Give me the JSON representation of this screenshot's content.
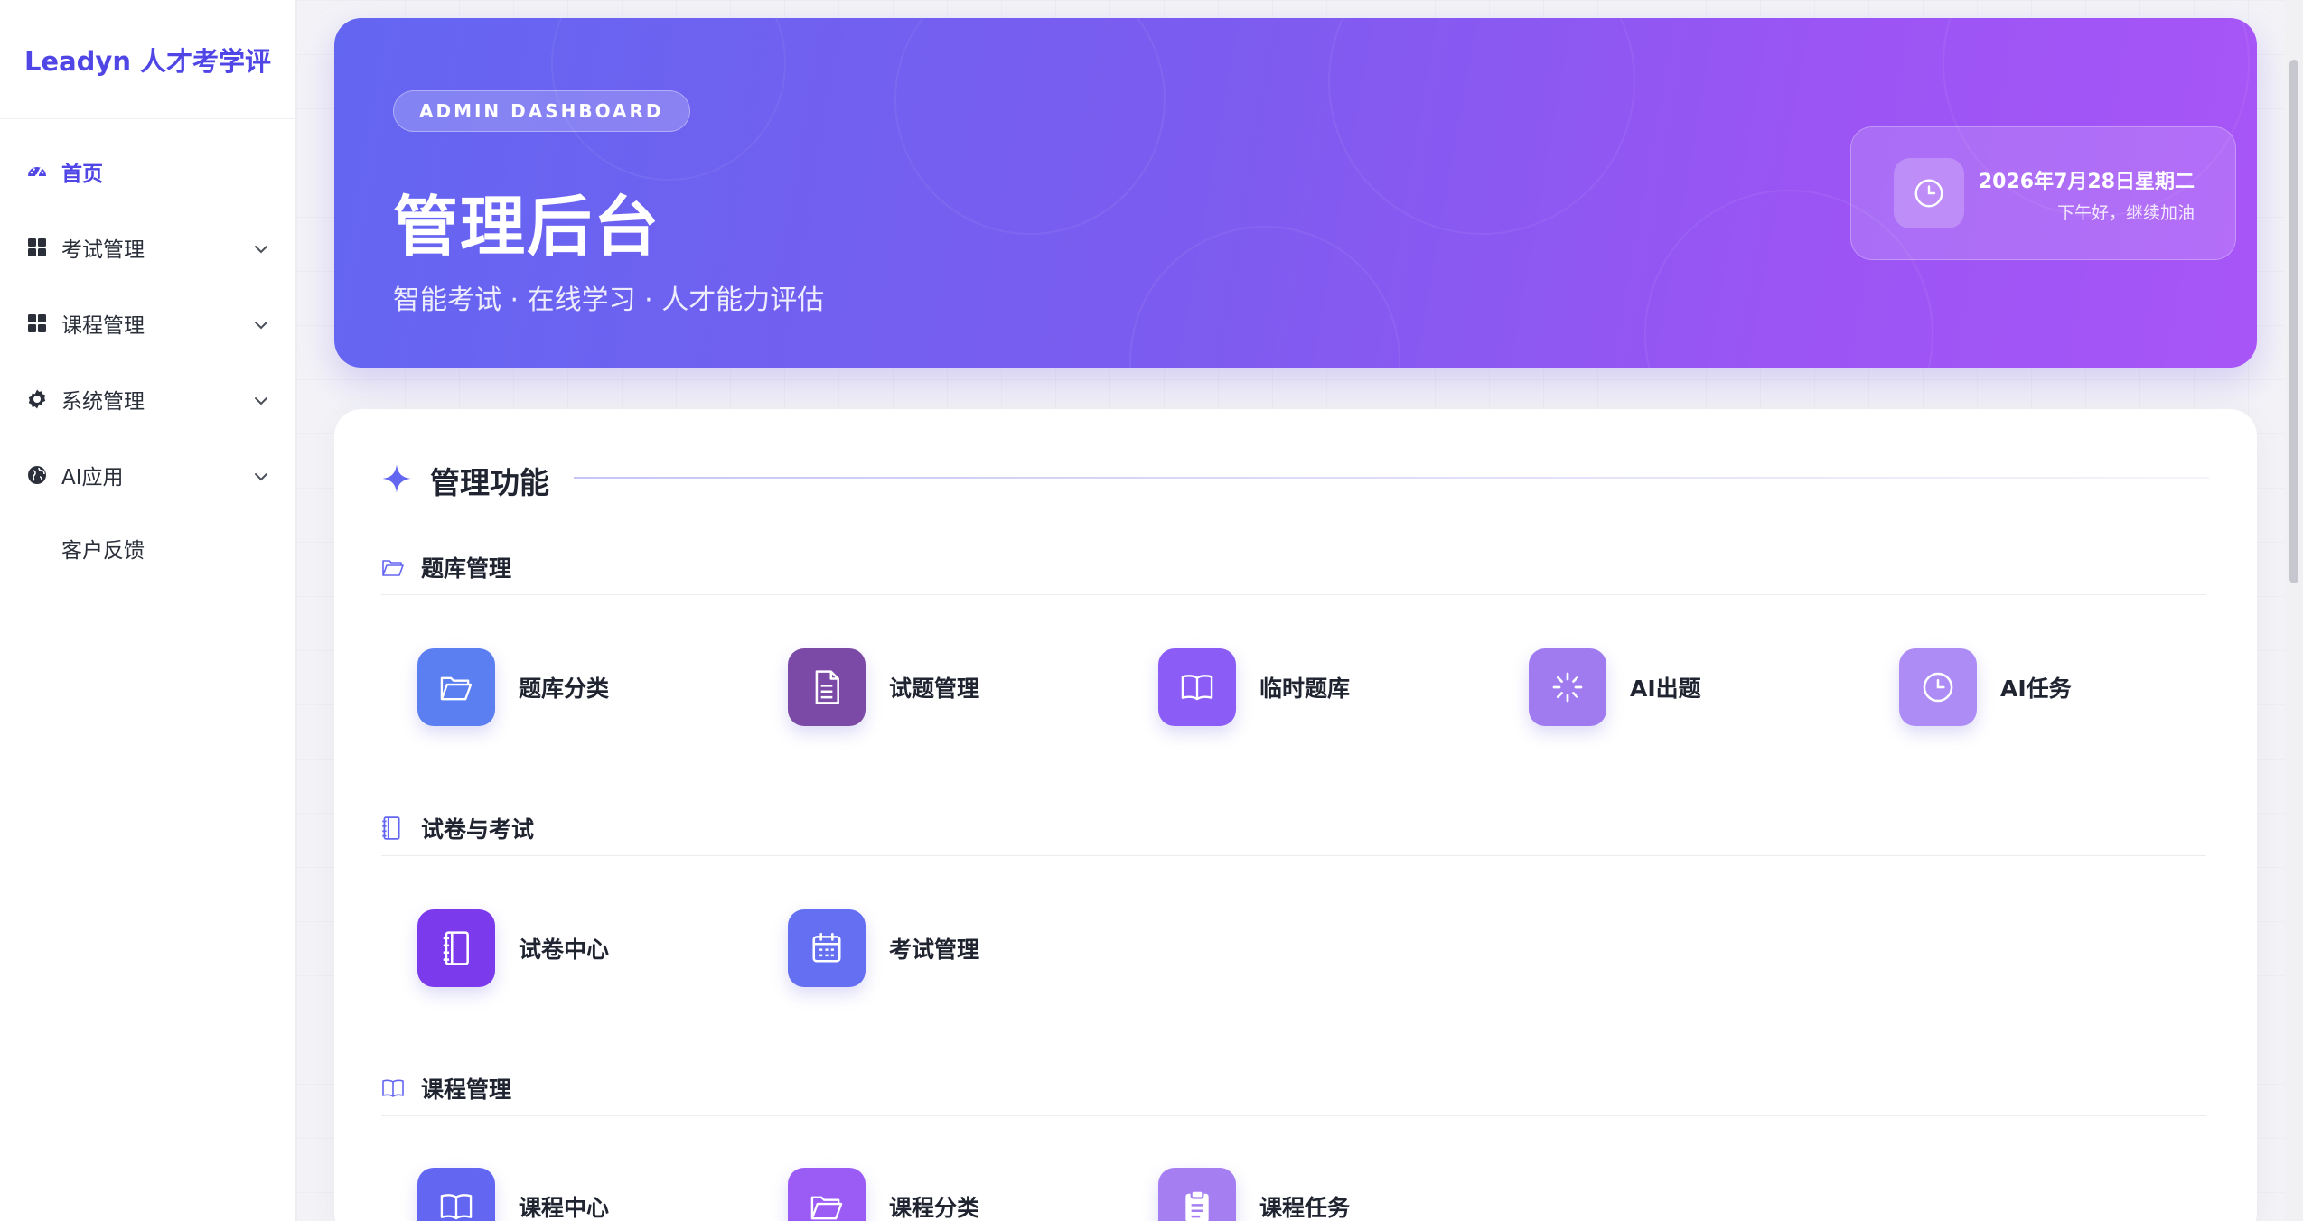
{
  "sidebar": {
    "logo": "Leadyn 人才考学评",
    "items": [
      {
        "label": "首页",
        "icon": "dashboard-icon",
        "active": true
      },
      {
        "label": "考试管理",
        "icon": "grid-icon"
      },
      {
        "label": "课程管理",
        "icon": "grid-icon"
      },
      {
        "label": "系统管理",
        "icon": "gear-icon"
      },
      {
        "label": "AI应用",
        "icon": "globe-icon"
      },
      {
        "label": "客户反馈"
      }
    ]
  },
  "hero": {
    "badge": "ADMIN DASHBOARD",
    "title": "管理后台",
    "subtitle": "智能考试 · 在线学习 · 人才能力评估",
    "date": "2026年7月28日星期二",
    "greeting": "下午好，继续加油"
  },
  "panel": {
    "title": "管理功能",
    "sections": [
      {
        "title": "题库管理",
        "tiles": [
          {
            "label": "题库分类",
            "icon": "folder-icon",
            "color": "#5b7ff0"
          },
          {
            "label": "试题管理",
            "icon": "document-icon",
            "color": "#7b4aa6"
          },
          {
            "label": "临时题库",
            "icon": "book-open-icon",
            "color": "#8b5cf6"
          },
          {
            "label": "AI出题",
            "icon": "loader-icon",
            "color": "#a07bef"
          },
          {
            "label": "AI任务",
            "icon": "clock-icon",
            "color": "#ad8cf5"
          }
        ]
      },
      {
        "title": "试卷与考试",
        "tiles": [
          {
            "label": "试卷中心",
            "icon": "notebook-icon",
            "color": "#7c3aed"
          },
          {
            "label": "考试管理",
            "icon": "calendar-icon",
            "color": "#6470f1"
          }
        ]
      },
      {
        "title": "课程管理",
        "tiles": [
          {
            "label": "课程中心",
            "icon": "book-open-icon",
            "color": "#6366f1"
          },
          {
            "label": "课程分类",
            "icon": "folder-icon",
            "color": "#9b5cf6"
          },
          {
            "label": "课程任务",
            "icon": "clipboard-icon",
            "color": "#a57ef2"
          }
        ]
      }
    ]
  }
}
